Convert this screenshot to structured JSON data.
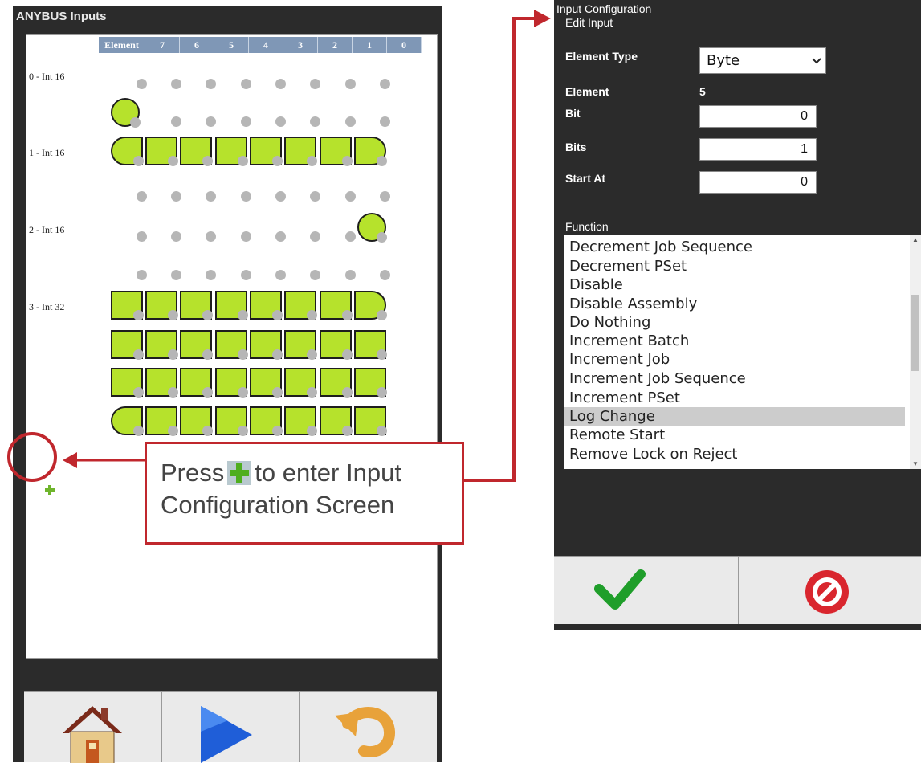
{
  "left_panel": {
    "title": "ANYBUS Inputs",
    "columns": [
      "Element",
      "7",
      "6",
      "5",
      "4",
      "3",
      "2",
      "1",
      "0"
    ],
    "element_labels": [
      "0 - Int 16",
      "1 - Int 16",
      "2 - Int 16",
      "3 - Int 32"
    ],
    "toolbar": {
      "home_icon": "home-icon",
      "play_icon": "play-icon",
      "undo_icon": "undo-icon"
    }
  },
  "callout": {
    "text_before": "Press",
    "text_after": "to enter Input",
    "text_line2": "Configuration Screen"
  },
  "right_panel": {
    "title": "Input Configuration",
    "subtitle": "Edit Input",
    "element_type_label": "Element Type",
    "element_type_value": "Byte",
    "element_label": "Element",
    "element_value": "5",
    "bit_label": "Bit",
    "bit_value": "0",
    "bits_label": "Bits",
    "bits_value": "1",
    "start_at_label": "Start At",
    "start_at_value": "0",
    "function_label": "Function",
    "functions": [
      "Decrement Job Sequence",
      "Decrement PSet",
      "Disable",
      "Disable Assembly",
      "Do Nothing",
      "Increment Batch",
      "Increment Job",
      "Increment Job Sequence",
      "Increment PSet",
      "Log Change",
      "Remote Start",
      "Remove Lock on Reject"
    ],
    "selected_function": "Log Change",
    "accept_icon": "check-icon",
    "cancel_icon": "cancel-icon"
  },
  "colors": {
    "panel_bg": "#2b2b2b",
    "header_blue": "#7f97b6",
    "bit_green": "#b6e22c",
    "inactive_dot": "#b6b6b6",
    "callout_red": "#c0272d",
    "plus_green": "#6fb52c"
  }
}
